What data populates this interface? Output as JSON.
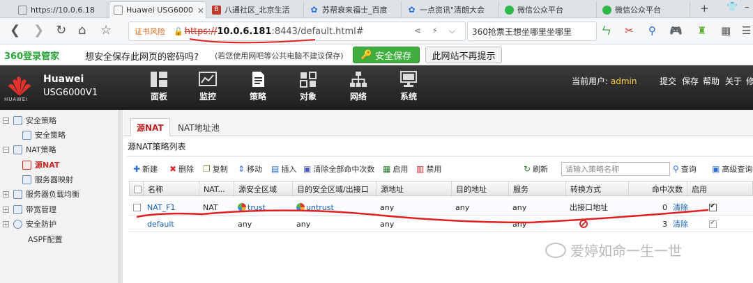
{
  "browser": {
    "tabs": [
      {
        "title": "https://10.0.6.18",
        "favicon": "page-icon",
        "active": false
      },
      {
        "title": "Huawei USG6000",
        "favicon": "page-icon",
        "active": true
      },
      {
        "title": "八通社区_北京生活",
        "favicon": "b-icon",
        "active": false
      },
      {
        "title": "苏帮衰来福士_百度",
        "favicon": "paw-icon",
        "active": false
      },
      {
        "title": "一点资讯\"清朗大会",
        "favicon": "paw-icon",
        "active": false
      },
      {
        "title": "微信公众平台",
        "favicon": "wechat-icon",
        "active": false
      },
      {
        "title": "微信公众平台",
        "favicon": "wechat-icon",
        "active": false
      }
    ],
    "new_tab": "+",
    "address": {
      "cert_warning": "证书风险",
      "protocol": "https://",
      "host": "10.0.6.181",
      "rest": ":8443/default.html#"
    },
    "search_text": "360抢票王想坐哪里坐哪里"
  },
  "password_bar": {
    "logo": "360登录管家",
    "question": "想安全保存此网页的密码吗?",
    "note": "(若您使用网吧等公共电脑不建议保存)",
    "save_label": "安全保存",
    "never_label": "此网站不再提示"
  },
  "app": {
    "brand": "HUAWEI",
    "vendor": "Huawei",
    "model": "USG6000V1",
    "nav": [
      {
        "label": "面板"
      },
      {
        "label": "监控"
      },
      {
        "label": "策略"
      },
      {
        "label": "对象"
      },
      {
        "label": "网络"
      },
      {
        "label": "系统"
      }
    ],
    "current_user_label": "当前用户:",
    "current_user": "admin",
    "header_links": [
      "提交",
      "保存",
      "帮助",
      "关于",
      "修"
    ]
  },
  "sidebar": {
    "items": [
      {
        "label": "安全策略",
        "expander": "−"
      },
      {
        "label": "安全策略",
        "expander": ""
      },
      {
        "label": "NAT策略",
        "expander": "−"
      },
      {
        "label": "源NAT",
        "expander": ""
      },
      {
        "label": "服务器映射",
        "expander": ""
      },
      {
        "label": "服务器负载均衡",
        "expander": "+"
      },
      {
        "label": "带宽管理",
        "expander": "+"
      },
      {
        "label": "安全防护",
        "expander": "+"
      },
      {
        "label": "ASPF配置",
        "expander": ""
      }
    ]
  },
  "content": {
    "tabs": [
      "源NAT",
      "NAT地址池"
    ],
    "panel_title": "源NAT策略列表",
    "toolbar": {
      "new": "新建",
      "delete": "删除",
      "copy": "复制",
      "move": "移动",
      "insert": "插入",
      "clear_all": "清除全部命中次数",
      "enable": "启用",
      "disable": "禁用",
      "refresh": "刷新",
      "search_placeholder": "请输入策略名称",
      "query": "查询",
      "advanced": "高级查询"
    },
    "columns": [
      "名称",
      "NAT...",
      "源安全区域",
      "目的安全区域/出接口",
      "源地址",
      "目的地址",
      "服务",
      "转换方式",
      "命中次数",
      "启用"
    ],
    "rows": [
      {
        "name": "NAT_F1",
        "nat_type": "NAT",
        "src_zone": "trust",
        "dst_zone": "untrust",
        "src_addr": "any",
        "dst_addr": "any",
        "service": "any",
        "mode": "出接口地址",
        "hits": "0",
        "clear": "清除",
        "enabled": true
      },
      {
        "name": "default",
        "nat_type": "",
        "src_zone": "any",
        "dst_zone": "any",
        "src_addr": "any",
        "dst_addr": "",
        "service": "any",
        "mode": "",
        "hits": "3",
        "clear": "清除",
        "enabled": true
      }
    ]
  },
  "watermark": "爱婷如命一生一世",
  "colors": {
    "accent_red": "#c62828",
    "link_blue": "#1a5fb4",
    "save_green": "#3fae3f",
    "header_dark": "#2a2a2a",
    "annotation_red": "#e02020"
  }
}
